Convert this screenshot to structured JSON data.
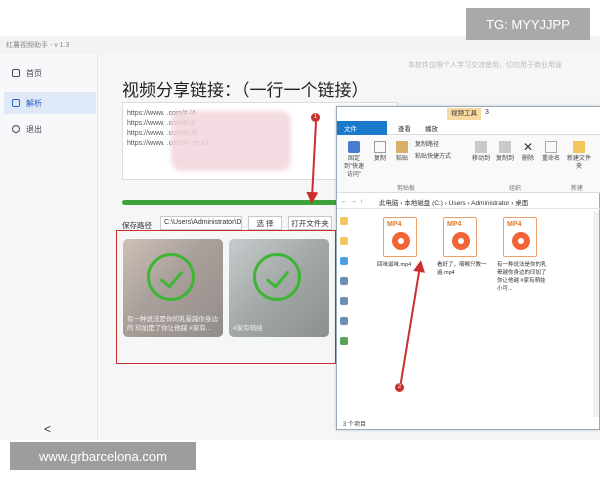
{
  "app": {
    "window_title": "红薯视频助手 - v 1.3",
    "sidebar": [
      {
        "label": "首页",
        "icon": "home-icon"
      },
      {
        "label": "解析",
        "icon": "parse-icon"
      },
      {
        "label": "退出",
        "icon": "exit-icon"
      }
    ],
    "collapse_glyph": "<",
    "hint": "本软件仅限个人学习交流使用，切勿用于商业用途",
    "heading": "视频分享链接：（一行一个链接）",
    "links": [
      "https://www.          .com/#            /4",
      "https://www.          .com/#            /8",
      "https://www.          .com/#/           /6",
      "https://www.          .com/#/           Ye        /U"
    ],
    "progress": 1.0,
    "save_label": "保存路径",
    "save_path": "C:\\Users\\Administrator\\D",
    "choose_button": "选 择",
    "open_folder_button": "打开文件夹",
    "cards": [
      {
        "caption": "有一种说法是你的乳晕越你身边的 印加是了你让他越 #家有..."
      },
      {
        "caption": "#家有萌娃"
      }
    ],
    "colors": {
      "accent": "#3ea23a",
      "annotation": "#c9302c",
      "selected": "#2a62c9"
    }
  },
  "explorer": {
    "tool_tab": "视频工具",
    "title_number": "3",
    "tabs": [
      "文件",
      "主页",
      "共享",
      "查看",
      "播放"
    ],
    "ribbon": [
      "固定到\"快速访问\"",
      "复制",
      "粘贴",
      "复制路径",
      "粘贴快捷方式",
      "移动到",
      "复制到",
      "删除",
      "重命名",
      "新建文件夹"
    ],
    "groups": [
      "剪贴板",
      "组织",
      "新建"
    ],
    "address": [
      "此电脑",
      "本地磁盘 (C:)",
      "Users",
      "Administrator",
      "桌面"
    ],
    "files": [
      {
        "type": "MP4",
        "name": "回味滋味.mp4"
      },
      {
        "type": "MP4",
        "name": "看好了，咽喉只教一遍.mp4"
      },
      {
        "type": "MP4",
        "name": "有一种说法是你的乳晕越你身边的印加了你让他越 #家有萌娃小可..."
      }
    ],
    "status": "3 个项目"
  },
  "annotations": {
    "callout_1": "1",
    "callout_2": "2"
  },
  "overlays": {
    "telegram": "TG: MYYJJPP",
    "website": "www.grbarcelona.com"
  }
}
